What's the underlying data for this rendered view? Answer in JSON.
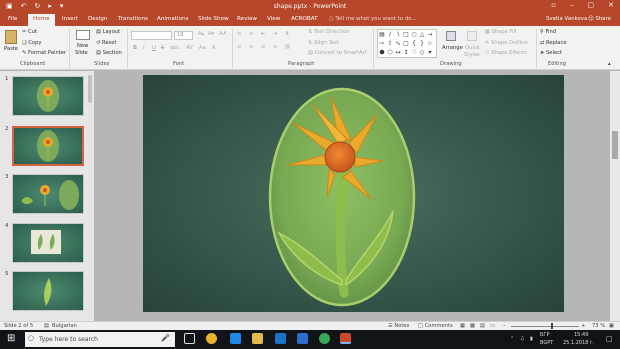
{
  "window": {
    "title": "shape.pptx - PowerPoint"
  },
  "tabs": [
    {
      "label": "File"
    },
    {
      "label": "Home"
    },
    {
      "label": "Insert"
    },
    {
      "label": "Design"
    },
    {
      "label": "Transitions"
    },
    {
      "label": "Animations"
    },
    {
      "label": "Slide Show"
    },
    {
      "label": "Review"
    },
    {
      "label": "View"
    },
    {
      "label": "ACROBAT"
    }
  ],
  "tell_me": "Tell me what you want to do...",
  "user_name": "Svetla Vankova",
  "share_label": "Share",
  "ribbon": {
    "clipboard": {
      "paste": "Paste",
      "cut": "Cut",
      "copy": "Copy",
      "format_painter": "Format Painter",
      "group": "Clipboard"
    },
    "slides": {
      "new_slide": "New",
      "new_slide2": "Slide",
      "layout": "Layout",
      "reset": "Reset",
      "section": "Section",
      "group": "Slides"
    },
    "font": {
      "size": "18",
      "bold": "B",
      "italic": "I",
      "underline": "U",
      "strike": "S",
      "shadow": "abc",
      "group": "Font"
    },
    "paragraph": {
      "text_direction": "Text Direction",
      "align_text": "Align Text",
      "convert_smartart": "Convert to SmartArt",
      "group": "Paragraph"
    },
    "drawing": {
      "arrange": "Arrange",
      "quick_styles": "Quick",
      "quick_styles2": "Styles",
      "shape_fill": "Shape Fill",
      "shape_outline": "Shape Outline",
      "shape_effects": "Shape Effects",
      "group": "Drawing"
    },
    "editing": {
      "find": "Find",
      "replace": "Replace",
      "select": "Select",
      "group": "Editing"
    }
  },
  "thumbnails": [
    {
      "number": "1"
    },
    {
      "number": "2"
    },
    {
      "number": "3"
    },
    {
      "number": "4"
    },
    {
      "number": "5"
    }
  ],
  "status": {
    "slide_info": "Slide 2 of 5",
    "language": "Bulgarian",
    "notes": "Notes",
    "comments": "Comments",
    "zoom": "73 %"
  },
  "taskbar": {
    "search_placeholder": "Type here to search",
    "language": "БГР",
    "language2": "BGPT",
    "time": "15:49",
    "date": "25.1.2018 г."
  },
  "colors": {
    "accent": "#b7472a",
    "slide_bg": "#36574b",
    "petal": "#e9a92a",
    "leaf": "#8fbd4a"
  }
}
